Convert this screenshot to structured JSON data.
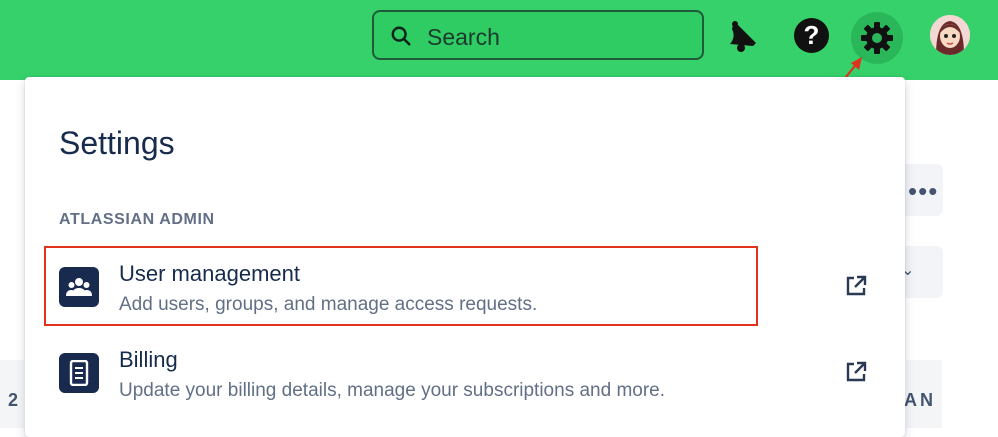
{
  "header": {
    "search_placeholder": "Search",
    "icons": [
      "search-icon",
      "bell-icon",
      "help-icon",
      "gear-icon",
      "avatar"
    ],
    "help_glyph": "?",
    "colors": {
      "bar": "#36d16a",
      "gear_active": "#29b75a"
    }
  },
  "settings_panel": {
    "title": "Settings",
    "section_label": "ATLASSIAN ADMIN",
    "items": [
      {
        "title": "User management",
        "description": "Add users, groups, and manage access requests.",
        "icon": "users-icon",
        "trailing_icon": "external-link-icon",
        "highlighted": true
      },
      {
        "title": "Billing",
        "description": "Update your billing details, manage your subscriptions and more.",
        "icon": "billing-document-icon",
        "trailing_icon": "external-link-icon",
        "highlighted": false
      }
    ]
  },
  "background": {
    "more_glyph": "•••",
    "chevron_glyph": "⌄",
    "left_fragment": "2",
    "right_fragment": "AN"
  },
  "annotation": {
    "arrow_color": "#e0321c",
    "highlight_color": "#e0321c"
  }
}
